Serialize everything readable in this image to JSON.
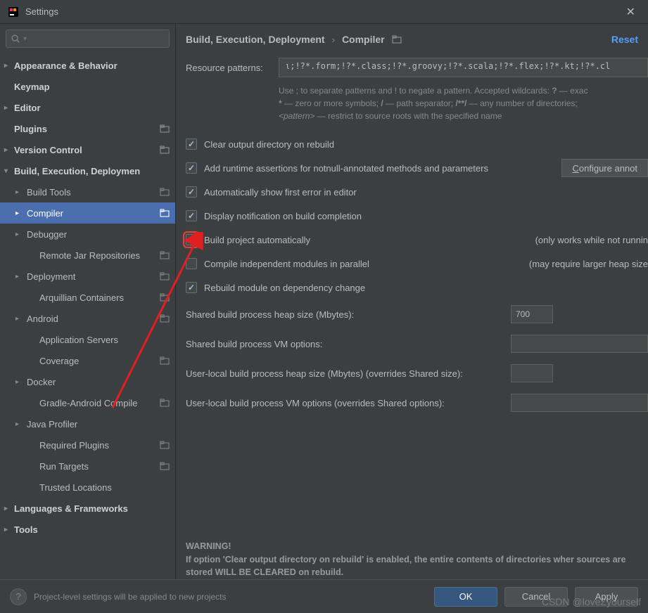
{
  "window": {
    "title": "Settings"
  },
  "breadcrumb": {
    "a": "Build, Execution, Deployment",
    "b": "Compiler",
    "reset": "Reset"
  },
  "sidebar": {
    "items": [
      {
        "label": "Appearance & Behavior",
        "chev": ">",
        "bold": true,
        "depth": 0
      },
      {
        "label": "Keymap",
        "depth": 0,
        "bold": true
      },
      {
        "label": "Editor",
        "chev": ">",
        "bold": true,
        "depth": 0
      },
      {
        "label": "Plugins",
        "depth": 0,
        "bold": true,
        "proj": true
      },
      {
        "label": "Version Control",
        "chev": ">",
        "bold": true,
        "depth": 0,
        "proj": true
      },
      {
        "label": "Build, Execution, Deploymen",
        "chev": "v",
        "bold": true,
        "depth": 0
      },
      {
        "label": "Build Tools",
        "chev": ">",
        "depth": 1,
        "proj": true
      },
      {
        "label": "Compiler",
        "chev": ">",
        "depth": 1,
        "selected": true,
        "proj": true
      },
      {
        "label": "Debugger",
        "chev": ">",
        "depth": 1
      },
      {
        "label": "Remote Jar Repositories",
        "depth": 2,
        "proj": true
      },
      {
        "label": "Deployment",
        "chev": ">",
        "depth": 1,
        "proj": true
      },
      {
        "label": "Arquillian Containers",
        "depth": 2,
        "proj": true
      },
      {
        "label": "Android",
        "chev": ">",
        "depth": 1,
        "proj": true
      },
      {
        "label": "Application Servers",
        "depth": 2
      },
      {
        "label": "Coverage",
        "depth": 2,
        "proj": true
      },
      {
        "label": "Docker",
        "chev": ">",
        "depth": 1
      },
      {
        "label": "Gradle-Android Compile",
        "depth": 2,
        "proj": true
      },
      {
        "label": "Java Profiler",
        "chev": ">",
        "depth": 1
      },
      {
        "label": "Required Plugins",
        "depth": 2,
        "proj": true
      },
      {
        "label": "Run Targets",
        "depth": 2,
        "proj": true
      },
      {
        "label": "Trusted Locations",
        "depth": 2
      },
      {
        "label": "Languages & Frameworks",
        "chev": ">",
        "bold": true,
        "depth": 0
      },
      {
        "label": "Tools",
        "chev": ">",
        "bold": true,
        "depth": 0
      }
    ]
  },
  "patterns": {
    "label": "Resource patterns:",
    "value": "ι;!?*.form;!?*.class;!?*.groovy;!?*.scala;!?*.flex;!?*.kt;!?*.cl"
  },
  "hint_lines": {
    "l1a": "Use ; to separate patterns and ! to negate a pattern. Accepted wildcards: ",
    "l1b": "?",
    "l1c": " — exac",
    "l2a": "*",
    "l2b": " — zero or more symbols; ",
    "l2c": "/",
    "l2d": " — path separator; ",
    "l2e": "/**/",
    "l2f": " — any number of directories;",
    "l3a": "<pattern>",
    "l3b": " — restrict to source roots with the specified name"
  },
  "checks": {
    "c1": "Clear output directory on rebuild",
    "c2": "Add runtime assertions for notnull-annotated methods and parameters",
    "c2btn_a": "C",
    "c2btn_b": "onfigure annot",
    "c3": "Automatically show first error in editor",
    "c4": "Display notification on build completion",
    "c5": "Build project automatically",
    "c5note": "(only works while not runnin",
    "c6": "Compile independent modules in parallel",
    "c6note": "(may require larger heap size",
    "c7": "Rebuild module on dependency change"
  },
  "fields": {
    "f1": "Shared build process heap size (Mbytes):",
    "f1v": "700",
    "f2": "Shared build process VM options:",
    "f2v": "",
    "f3": "User-local build process heap size (Mbytes) (overrides Shared size):",
    "f3v": "",
    "f4": "User-local build process VM options (overrides Shared options):",
    "f4v": ""
  },
  "warning": {
    "head": "WARNING!",
    "body": "If option 'Clear output directory on rebuild' is enabled, the entire contents of directories wher sources are stored WILL BE CLEARED on rebuild."
  },
  "footer": {
    "help": "?",
    "text": "Project-level settings will be applied to new projects",
    "ok": "OK",
    "cancel": "Cancel",
    "apply": "Apply"
  },
  "watermark": "CSDN @loveZyourself"
}
